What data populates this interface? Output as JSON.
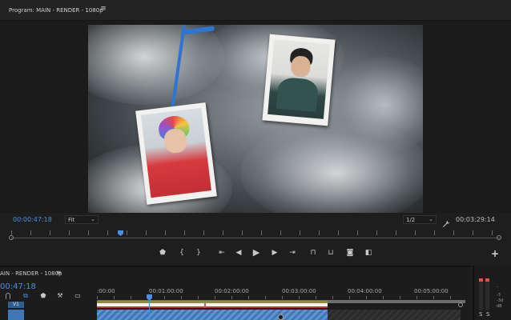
{
  "program_monitor": {
    "title": "Program: MAIN - RENDER - 1080p",
    "current_timecode": "00:00:47:18",
    "zoom_select": "Fit",
    "resolution_select": "1/2",
    "duration_timecode": "00:03:29:14",
    "transport_icons": [
      "marker-icon",
      "mark-in-icon",
      "mark-out-icon",
      "go-to-in-icon",
      "step-back-icon",
      "play-icon",
      "step-forward-icon",
      "go-to-out-icon",
      "lift-icon",
      "extract-icon",
      "export-frame-icon",
      "comparison-view-icon"
    ],
    "add_button_icon": "plus-icon"
  },
  "timeline": {
    "title": "AIN - RENDER - 1080p",
    "timecode": "00:47:18",
    "ruler_labels": [
      ":00:00",
      "00:01:00:00",
      "00:02:00:00",
      "00:03:00:00",
      "00:04:00:00",
      "00:05:00:00"
    ],
    "track_label": "V1",
    "playhead_position_seconds": 47.75
  },
  "audio_meter": {
    "scale_labels": [
      "-",
      "-3",
      "-3d",
      "dB"
    ],
    "solo_left": "S",
    "solo_right": "S"
  },
  "colors": {
    "accent_timecode": "#4b8fe2",
    "panel_bg": "#1e1e1e",
    "clip_video": "#3e78b6",
    "work_area": "#8e8e3e",
    "meter_peak": "#e05050"
  }
}
